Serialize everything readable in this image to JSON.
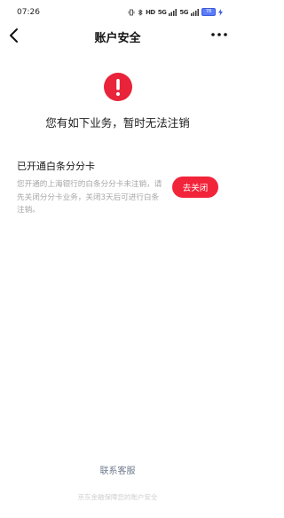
{
  "status_bar": {
    "time": "07:26",
    "net_label": "HD",
    "signal_1": "5G",
    "signal_2": "5G",
    "battery": "78"
  },
  "nav": {
    "title": "账户安全",
    "back_icon": "chevron-left-icon",
    "more_icon": "more-dots-icon"
  },
  "alert": {
    "icon": "exclamation-circle-icon",
    "color": "#e8233a",
    "headline": "您有如下业务，暂时无法注销"
  },
  "service": {
    "title": "已开通白条分分卡",
    "description": "您开通的上海银行的白条分分卡未注销，请先关闭分分卡业务，关闭3天后可进行白条注销。",
    "button_label": "去关闭",
    "button_color": "#f2243a"
  },
  "contact_label": "联系客服",
  "footer_text": "京东金融保障您的账户安全"
}
